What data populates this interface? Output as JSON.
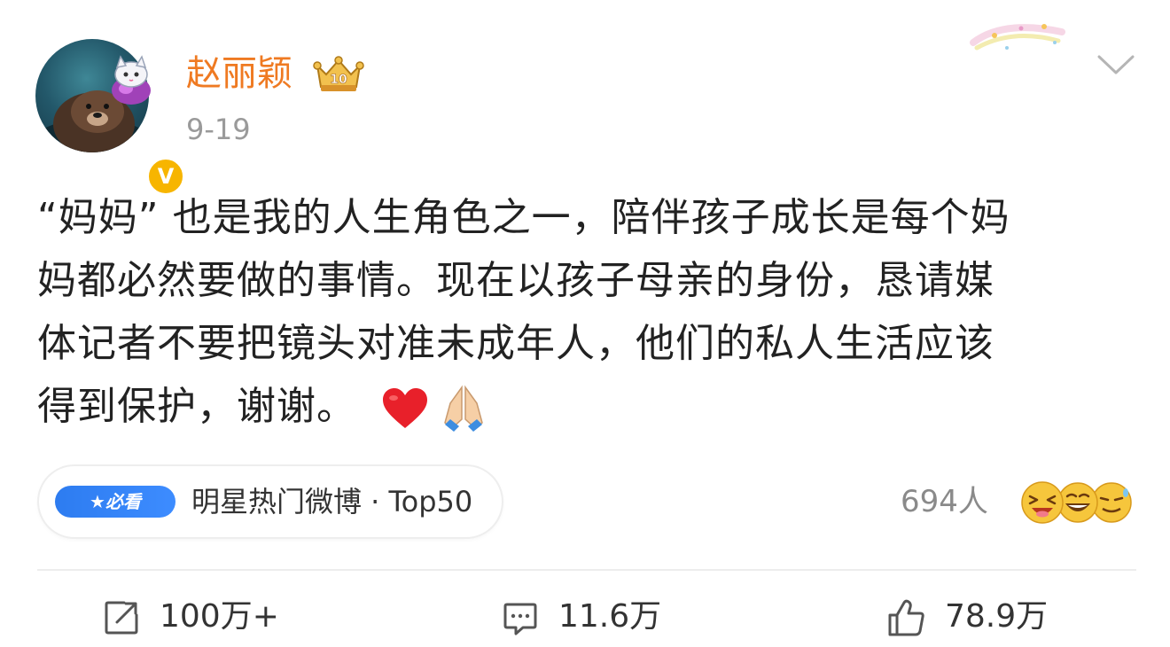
{
  "author": {
    "name": "赵丽颖",
    "vip_level": "10",
    "verified": "V",
    "date": "9-19"
  },
  "post": {
    "lines": [
      "“妈妈” 也是我的人生角色之一，陪伴孩子成长是每个妈",
      "妈都必然要做的事情。现在以孩子母亲的身份，恳请媒",
      "体记者不要把镜头对准未成年人，他们的私人生活应该",
      "得到保护，谢谢。"
    ],
    "emojis": [
      "red-heart-icon",
      "folded-hands-icon"
    ]
  },
  "topic": {
    "badge": "★必看",
    "label": "明星热门微博 · Top50"
  },
  "reactions": {
    "count": "694人",
    "faces": [
      "grinning-squint-icon",
      "laughing-icon",
      "sweat-smile-icon"
    ]
  },
  "actions": {
    "repost": "100万+",
    "comment": "11.6万",
    "like": "78.9万"
  },
  "colors": {
    "username": "#ef7a22",
    "verified": "#f7b500",
    "badge": "#2d7cf0",
    "heart": "#e8202a"
  }
}
